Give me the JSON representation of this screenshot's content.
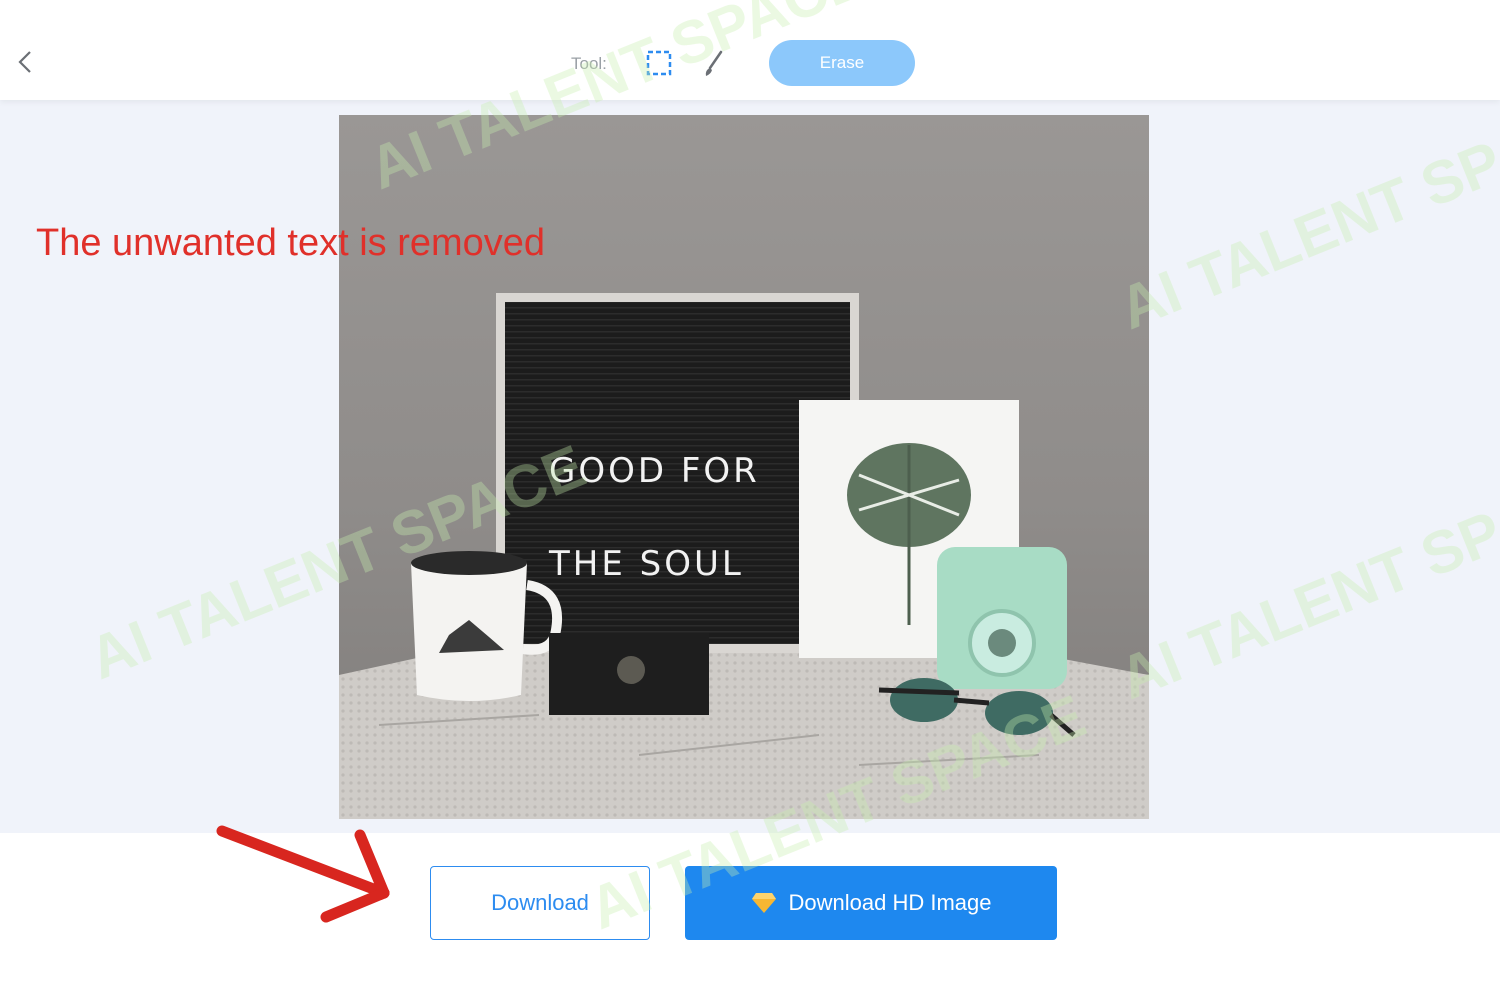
{
  "toolbar": {
    "back_icon": "chevron-left-icon",
    "tool_label": "Tool:",
    "tools": [
      "rect-select-icon",
      "brush-icon"
    ],
    "erase_label": "Erase"
  },
  "colors": {
    "accent": "#2d8cf0",
    "erase_button": "#8cc8fb",
    "canvas_bg": "#f0f3fa",
    "annotation": "#e0302a"
  },
  "annotation": {
    "text": "The unwanted text is removed"
  },
  "image": {
    "letter_board_line1": "GOOD FOR",
    "letter_board_line2": "THE SOUL"
  },
  "actions": {
    "download_label": "Download",
    "download_hd_label": "Download HD Image",
    "hd_icon": "diamond-icon"
  },
  "watermark": {
    "text": "AI TALENT SPACE"
  }
}
